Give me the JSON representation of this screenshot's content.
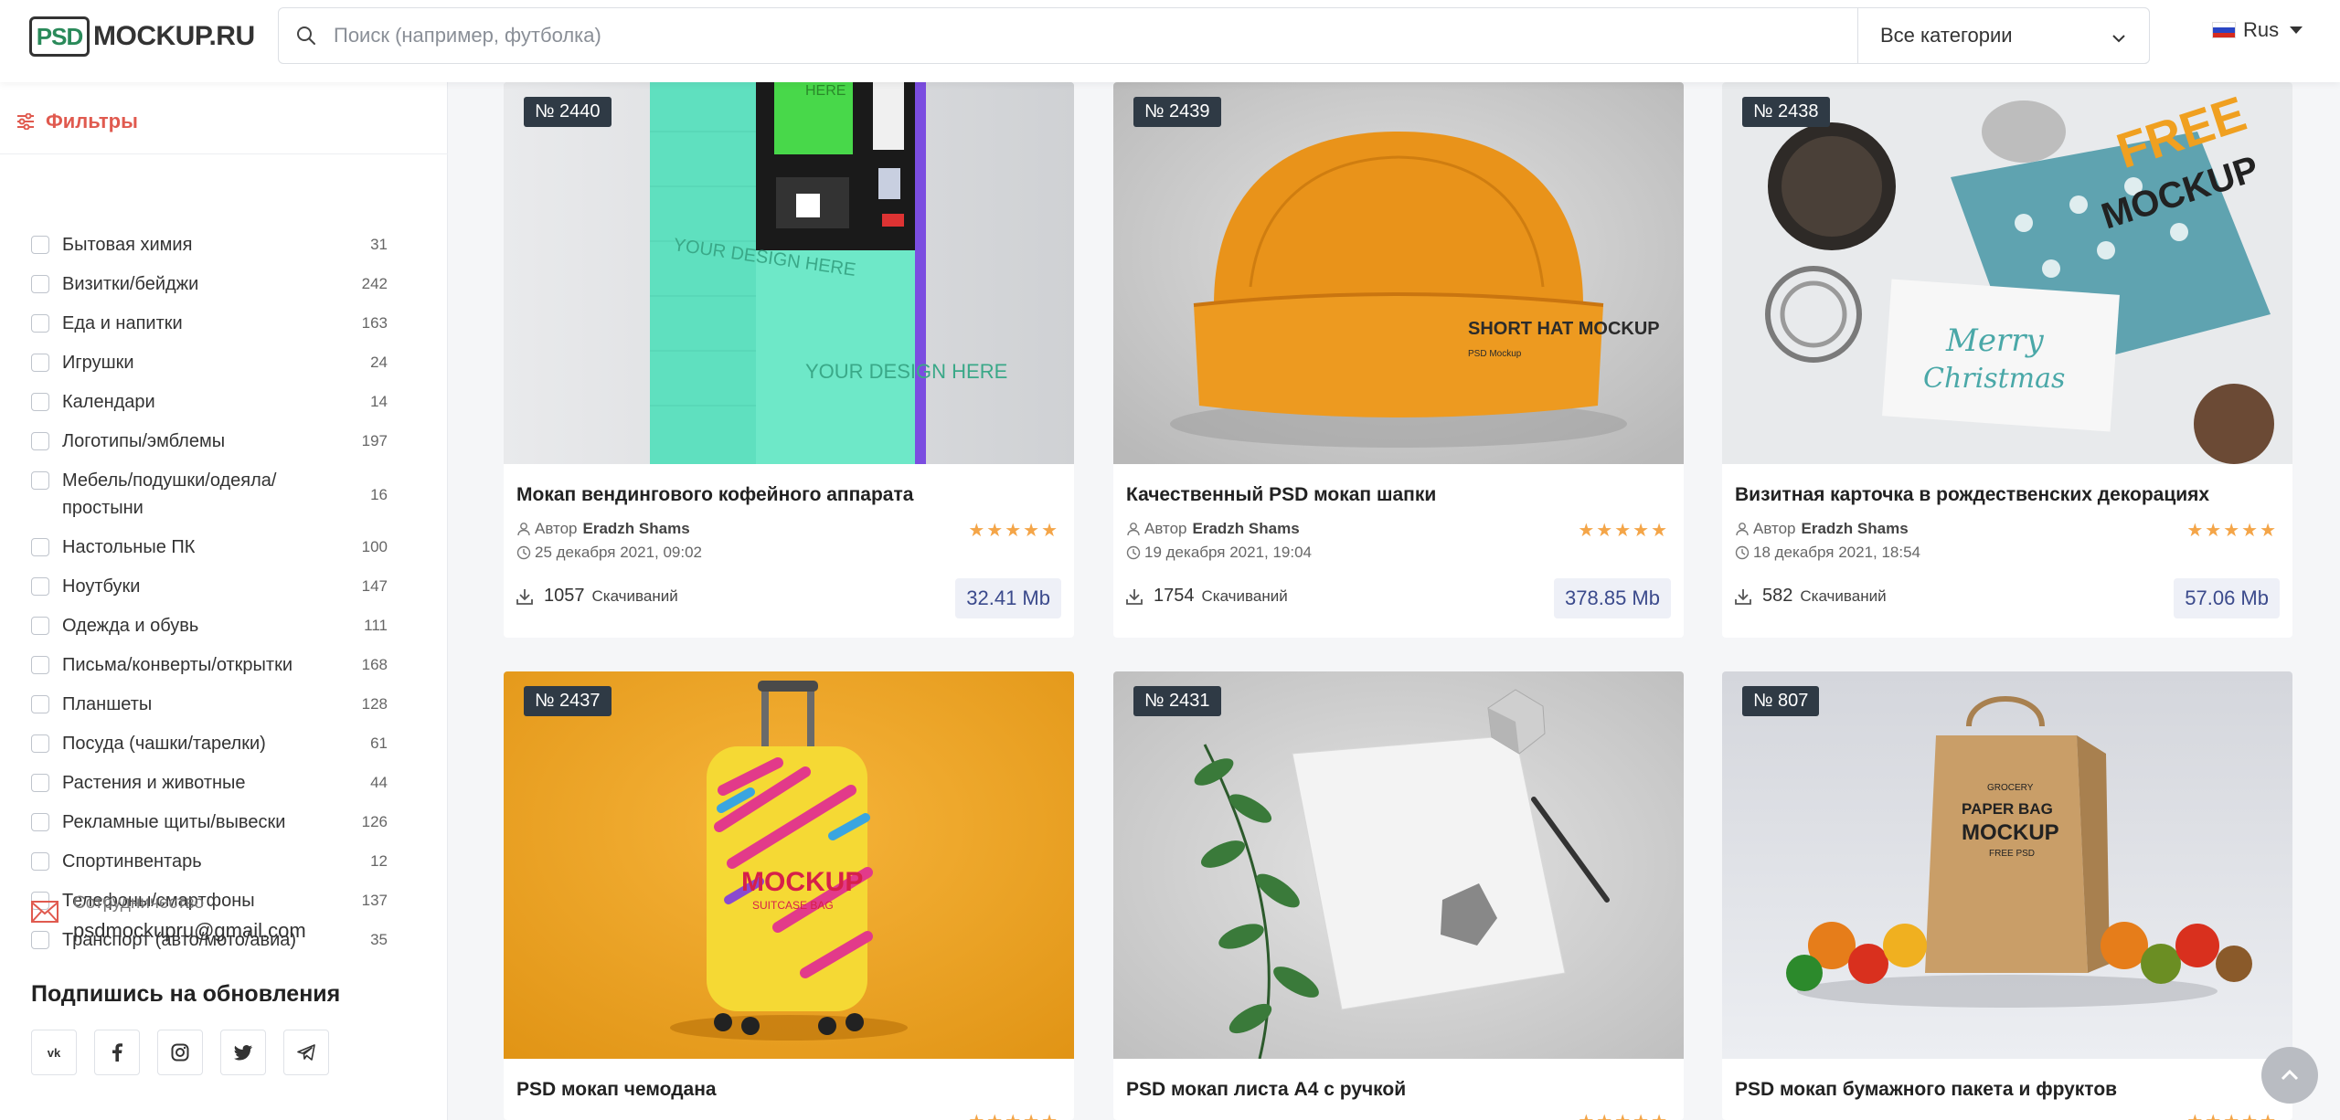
{
  "header": {
    "logo_text": "MOCKUP.RU",
    "logo_mark": "PSD",
    "search_placeholder": "Поиск (например, футболка)",
    "category_select": "Все категории",
    "language": "Rus"
  },
  "sidebar": {
    "filters_label": "Фильтры",
    "categories": [
      {
        "name": "Бытовая химия",
        "count": "31"
      },
      {
        "name": "Визитки/бейджи",
        "count": "242"
      },
      {
        "name": "Еда и напитки",
        "count": "163"
      },
      {
        "name": "Игрушки",
        "count": "24"
      },
      {
        "name": "Календари",
        "count": "14"
      },
      {
        "name": "Логотипы/эмблемы",
        "count": "197"
      },
      {
        "name": "Мебель/подушки/одеяла/простыни",
        "count": "16"
      },
      {
        "name": "Настольные ПК",
        "count": "100"
      },
      {
        "name": "Ноутбуки",
        "count": "147"
      },
      {
        "name": "Одежда и обувь",
        "count": "111"
      },
      {
        "name": "Письма/конверты/открытки",
        "count": "168"
      },
      {
        "name": "Планшеты",
        "count": "128"
      },
      {
        "name": "Посуда (чашки/тарелки)",
        "count": "61"
      },
      {
        "name": "Растения и животные",
        "count": "44"
      },
      {
        "name": "Рекламные щиты/вывески",
        "count": "126"
      },
      {
        "name": "Спортинвентарь",
        "count": "12"
      },
      {
        "name": "Телефоны/смартфоны",
        "count": "137"
      },
      {
        "name": "Транспорт (авто/мото/авиа)",
        "count": "35"
      }
    ],
    "contact_label": "Сотрудничество",
    "contact_email": "psdmockupru@gmail.com",
    "subscribe_title": "Подпишись на обновления",
    "socials": [
      "vk-icon",
      "facebook-icon",
      "instagram-icon",
      "twitter-icon",
      "telegram-icon"
    ]
  },
  "cards": [
    {
      "number": "№ 2440",
      "title": "Мокап вендингового кофейного аппарата",
      "author_label": "Автор",
      "author": "Eradzh Shams",
      "date": "25 декабря 2021, 09:02",
      "downloads": "1057",
      "downloads_label": "Скачиваний",
      "size": "32.41 Mb",
      "rating": "★★★★★"
    },
    {
      "number": "№ 2439",
      "title": "Качественный PSD мокап шапки",
      "author_label": "Автор",
      "author": "Eradzh Shams",
      "date": "19 декабря 2021, 19:04",
      "downloads": "1754",
      "downloads_label": "Скачиваний",
      "size": "378.85 Mb",
      "rating": "★★★★★"
    },
    {
      "number": "№ 2438",
      "title": "Визитная карточка в рождественских декорациях",
      "author_label": "Автор",
      "author": "Eradzh Shams",
      "date": "18 декабря 2021, 18:54",
      "downloads": "582",
      "downloads_label": "Скачиваний",
      "size": "57.06 Mb",
      "rating": "★★★★★"
    },
    {
      "number": "№ 2437",
      "title": "PSD мокап чемодана",
      "rating": "★★★★★"
    },
    {
      "number": "№ 2431",
      "title": "PSD мокап листа А4 с ручкой",
      "rating": "★★★★★"
    },
    {
      "number": "№ 807",
      "title": "PSD мокап бумажного пакета и фруктов",
      "rating": "★★★★★"
    }
  ],
  "image_texts": {
    "vending_top": "HERE",
    "vending_left": "YOUR DESIGN HERE",
    "vending_bottom": "YOUR DESIGN HERE",
    "hat": "SHORT HAT MOCKUP",
    "hat_small": "PSD Mockup",
    "xmas_free": "FREE",
    "xmas_mockup": "MOCKUP",
    "xmas_card_1": "Merry",
    "xmas_card_2": "Christmas",
    "suitcase": "MOCKUP",
    "suitcase_sub": "SUITCASE BAG",
    "bag_1": "GROCERY",
    "bag_2": "PAPER BAG",
    "bag_3": "MOCKUP",
    "bag_4": "FREE PSD"
  },
  "colors": {
    "accent": "#e05a4f",
    "badge": "#2f3a45",
    "star": "#f4a548",
    "size_text": "#3b4a8c",
    "size_bg": "#eef0f7"
  }
}
